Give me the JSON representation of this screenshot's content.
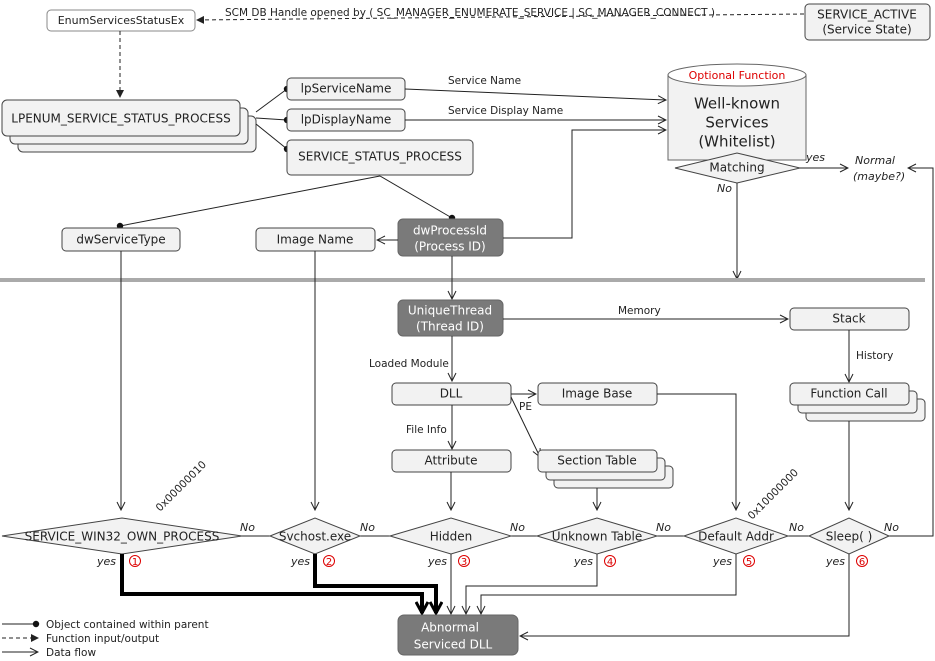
{
  "top": {
    "enum_func": "EnumServicesStatusEx",
    "scm_label": "SCM DB Handle opened by ( SC_MANAGER_ENUMERATE_SERVICE | SC_MANAGER_CONNECT )",
    "service_active": [
      "SERVICE_ACTIVE",
      "(Service State)"
    ]
  },
  "structs": {
    "lpenum": "LPENUM_SERVICE_STATUS_PROCESS",
    "lpServiceName": "lpServiceName",
    "lpDisplayName": "lpDisplayName",
    "service_status_process": "SERVICE_STATUS_PROCESS",
    "dwServiceType": "dwServiceType",
    "image_name": "Image Name",
    "dwProcessId": [
      "dwProcessId",
      "(Process ID)"
    ]
  },
  "edges": {
    "service_name": "Service Name",
    "service_display_name": "Service Display Name",
    "memory": "Memory",
    "history": "History",
    "loaded_module": "Loaded Module",
    "pe": "PE",
    "file_info": "File Info",
    "yes": "yes",
    "no": "No",
    "hex_own_process": "0x00000010",
    "hex_default_addr": "0x10000000"
  },
  "whitelist": {
    "optional": "Optional Function",
    "title": [
      "Well-known",
      "Services",
      "(Whitelist)"
    ],
    "matching": "Matching",
    "normal": [
      "Normal",
      "(maybe?)"
    ]
  },
  "thread": {
    "unique_thread": [
      "UniqueThread",
      "(Thread ID)"
    ],
    "stack": "Stack",
    "function_call": "Function Call",
    "dll": "DLL",
    "image_base": "Image Base",
    "attribute": "Attribute",
    "section_table": "Section Table"
  },
  "checks": [
    {
      "label": "SERVICE_WIN32_OWN_PROCESS",
      "num": "1"
    },
    {
      "label": "Svchost.exe",
      "num": "2"
    },
    {
      "label": "Hidden",
      "num": "3"
    },
    {
      "label": "Unknown Table",
      "num": "4"
    },
    {
      "label": "Default Addr",
      "num": "5"
    },
    {
      "label": "Sleep( )",
      "num": "6"
    }
  ],
  "result": [
    "Abnormal",
    "Serviced DLL"
  ],
  "legend": [
    "Object contained within parent",
    "Function input/output",
    "Data flow"
  ],
  "colors": {
    "accent_red": "#dd0000",
    "dark_box": "#7a7a7a",
    "divider": "#aaaaaa"
  }
}
